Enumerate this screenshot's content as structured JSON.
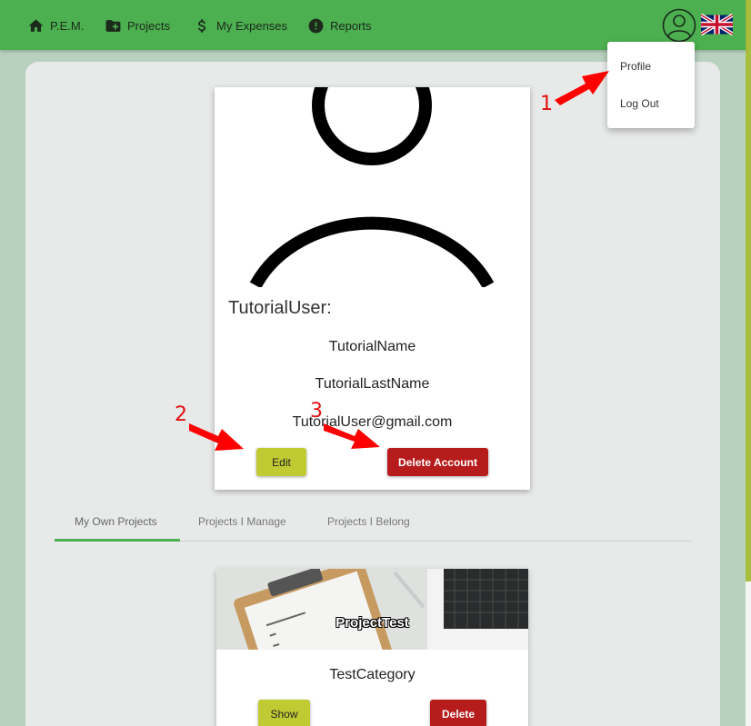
{
  "nav": {
    "home_label": "P.E.M.",
    "projects_label": "Projects",
    "expenses_label": "My Expenses",
    "reports_label": "Reports",
    "icons": [
      "home-icon",
      "folder-plus-icon",
      "dollar-icon",
      "alert-circle-icon",
      "account-icon",
      "uk-flag-icon"
    ]
  },
  "dropdown": {
    "items": [
      {
        "label": "Profile"
      },
      {
        "label": "Log Out"
      }
    ]
  },
  "profile": {
    "username": "TutorialUser:",
    "first_name": "TutorialName",
    "last_name": "TutorialLastName",
    "email": "TutorialUser@gmail.com",
    "edit_label": "Edit",
    "delete_label": "Delete Account"
  },
  "tabs": [
    {
      "label": "My Own Projects",
      "active": true
    },
    {
      "label": "Projects I Manage",
      "active": false
    },
    {
      "label": "Projects I Belong",
      "active": false
    }
  ],
  "project": {
    "title": "ProjectTest",
    "category": "TestCategory",
    "show_label": "Show",
    "delete_label": "Delete"
  },
  "annotations": [
    "1",
    "2",
    "3"
  ],
  "colors": {
    "navbar": "#4caf50",
    "accent_yellow": "#c0ca33",
    "danger": "#b71c1c",
    "annotation": "#e01010"
  }
}
